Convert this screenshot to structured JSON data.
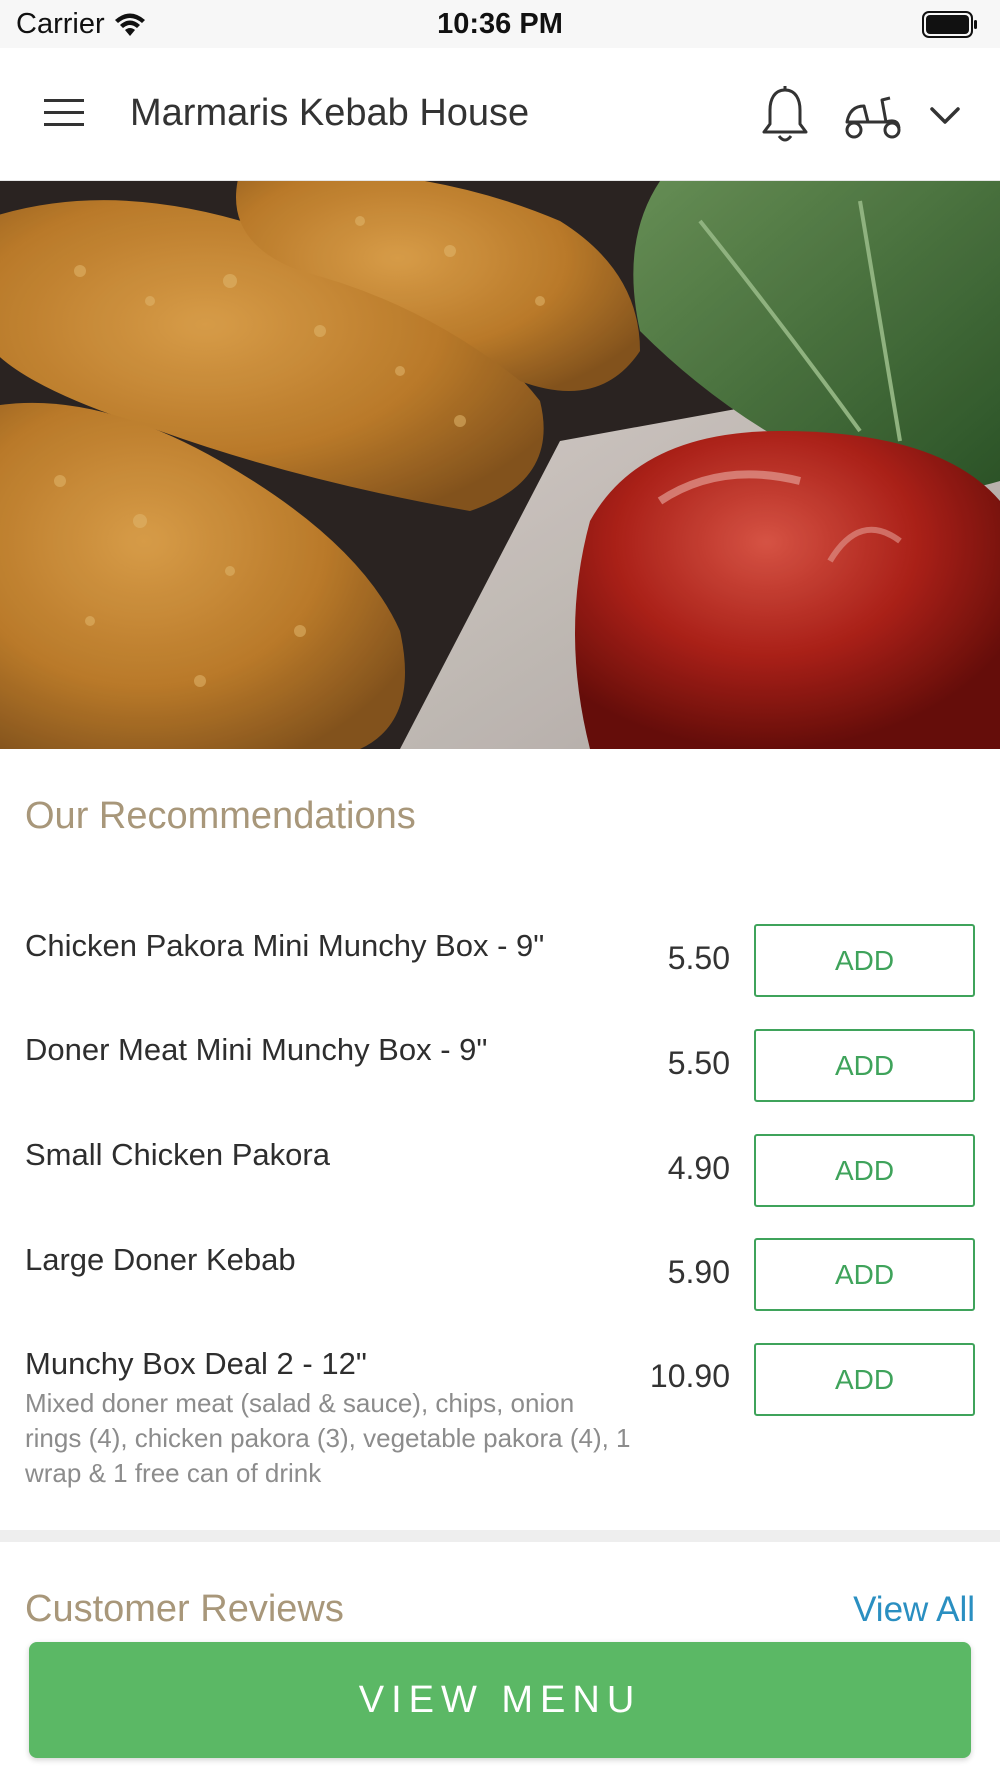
{
  "status_bar": {
    "carrier": "Carrier",
    "time": "10:36 PM"
  },
  "header": {
    "title": "Marmaris Kebab House",
    "icons": [
      "hamburger-menu-icon",
      "bell-icon",
      "delivery-scooter-icon",
      "chevron-down-icon"
    ]
  },
  "recommendations": {
    "title": "Our Recommendations",
    "items": [
      {
        "name": "Chicken Pakora Mini Munchy Box - 9\"",
        "price": "5.50",
        "button": "ADD"
      },
      {
        "name": "Doner Meat Mini Munchy Box - 9\"",
        "price": "5.50",
        "button": "ADD"
      },
      {
        "name": "Small Chicken Pakora",
        "price": "4.90",
        "button": "ADD"
      },
      {
        "name": "Large Doner Kebab",
        "price": "5.90",
        "button": "ADD"
      },
      {
        "name": "Munchy Box Deal 2 - 12\"",
        "price": "10.90",
        "button": "ADD",
        "description": "Mixed doner meat (salad & sauce), chips, onion rings (4), chicken pakora (3), vegetable pakora (4), 1 wrap & 1 free can of drink"
      }
    ]
  },
  "reviews": {
    "title": "Customer Reviews",
    "view_all": "View All"
  },
  "footer": {
    "view_menu": "VIEW MENU"
  },
  "colors": {
    "accent_green": "#5bb865",
    "add_border": "#3fa35b",
    "section_title": "#a8977a",
    "link_blue": "#2a8fc1"
  }
}
